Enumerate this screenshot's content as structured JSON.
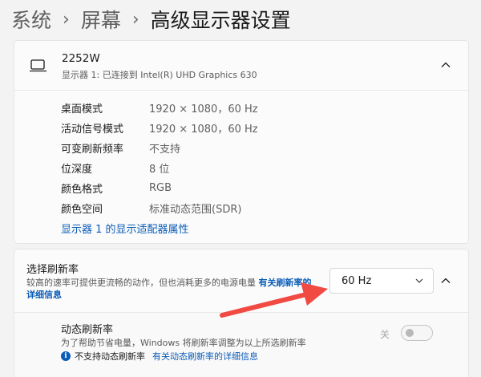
{
  "breadcrumb": {
    "parent": "系统",
    "middle": "屏幕",
    "current": "高级显示器设置"
  },
  "display": {
    "name": "2252W",
    "subtitle": "显示器 1: 已连接到 Intel(R) UHD Graphics 630",
    "info": [
      {
        "label": "桌面模式",
        "value": "1920 × 1080，60 Hz"
      },
      {
        "label": "活动信号模式",
        "value": "1920 × 1080，60 Hz"
      },
      {
        "label": "可变刷新频率",
        "value": "不支持"
      },
      {
        "label": "位深度",
        "value": "8 位"
      },
      {
        "label": "颜色格式",
        "value": "RGB"
      },
      {
        "label": "颜色空间",
        "value": "标准动态范围(SDR)"
      }
    ],
    "adapter_link": "显示器 1 的显示适配器属性"
  },
  "refresh": {
    "title": "选择刷新率",
    "desc": "较高的速率可提供更流畅的动作，但也消耗更多的电源电量",
    "desc_link": "有关刷新率的详细信息",
    "selected": "60 Hz",
    "dynamic": {
      "title": "动态刷新率",
      "desc": "为了帮助节省电量，Windows 将刷新率调整为以上所选刷新率",
      "note": "不支持动态刷新率",
      "note_link": "有关动态刷新率的详细信息",
      "toggle_label": "关",
      "toggle_on": false
    }
  },
  "colors": {
    "accent": "#0a5cb8",
    "annotation_arrow": "#f04a43"
  },
  "icons": {
    "monitor": "monitor-icon",
    "chevron_up": "chevron-up-icon",
    "chevron_down": "chevron-down-icon",
    "info": "info-icon"
  }
}
